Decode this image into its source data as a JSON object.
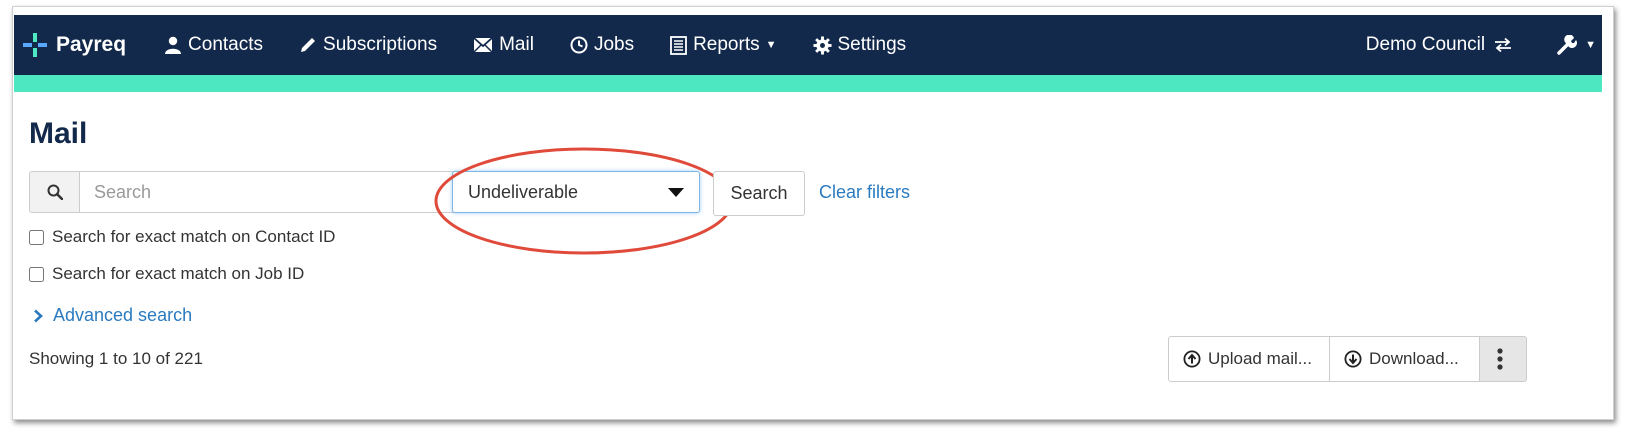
{
  "navbar": {
    "brand": "Payreq",
    "items": [
      {
        "label": "Contacts",
        "icon": "user-icon"
      },
      {
        "label": "Subscriptions",
        "icon": "pencil-icon"
      },
      {
        "label": "Mail",
        "icon": "envelope-icon"
      },
      {
        "label": "Jobs",
        "icon": "clock-icon"
      },
      {
        "label": "Reports",
        "icon": "list-icon",
        "dropdown": true
      },
      {
        "label": "Settings",
        "icon": "gear-icon"
      }
    ],
    "organization": "Demo Council",
    "organization_icon": "switch-arrows-icon",
    "tools_icon": "wrench-icon"
  },
  "colors": {
    "navbar_bg": "#13294b",
    "accent": "#4de8c2",
    "link": "#2a7ac0",
    "highlight": "#e04a3a"
  },
  "page": {
    "title": "Mail"
  },
  "search": {
    "placeholder": "Search",
    "value": "",
    "status_filter": "Undeliverable",
    "button_label": "Search",
    "clear_label": "Clear filters"
  },
  "options": {
    "exact_contact_id": "Search for exact match on Contact ID",
    "exact_job_id": "Search for exact match on Job ID",
    "advanced_label": "Advanced search"
  },
  "results": {
    "summary": "Showing 1 to 10 of 221"
  },
  "actions": {
    "upload_label": "Upload mail...",
    "download_label": "Download...",
    "more_icon": "vertical-ellipsis-icon"
  }
}
